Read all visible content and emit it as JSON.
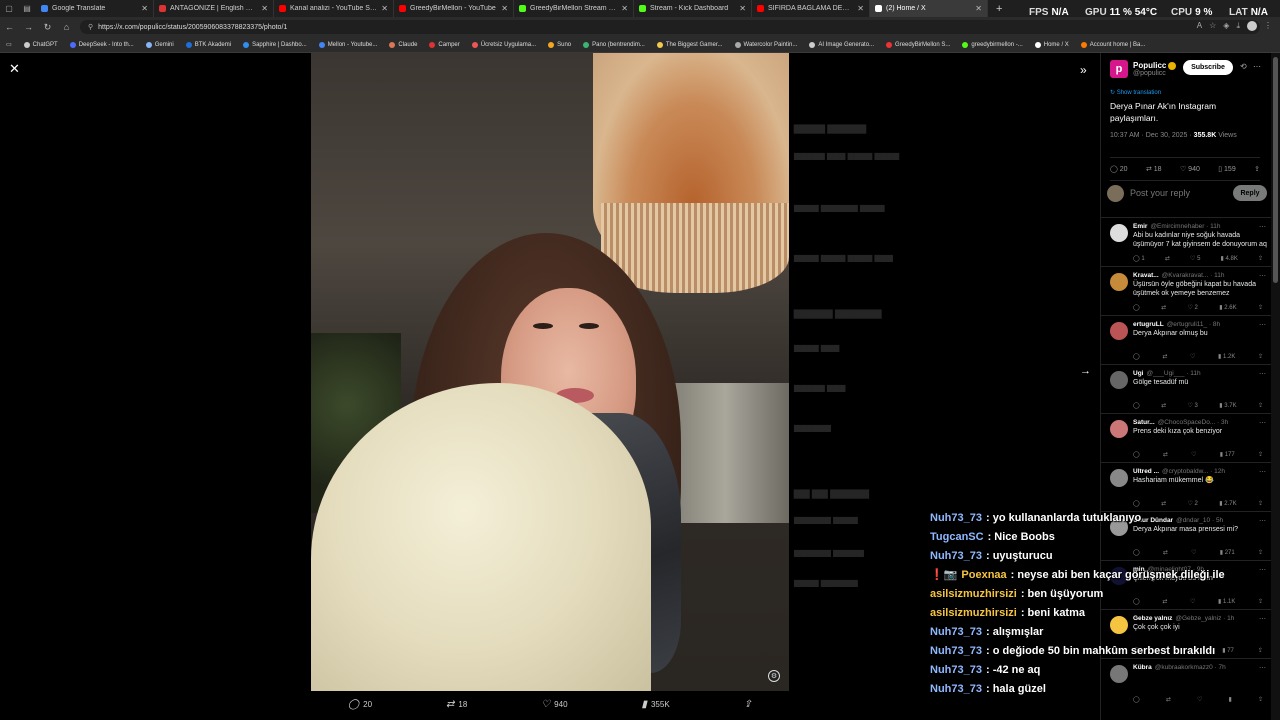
{
  "browser": {
    "tabs": [
      {
        "title": "Google Translate",
        "color": "#4285f4",
        "width": 118
      },
      {
        "title": "ANTAGONIZE | English meaning -",
        "color": "#d33",
        "width": 120
      },
      {
        "title": "Kanal analizi - YouTube Studio",
        "color": "#ff0000",
        "width": 120
      },
      {
        "title": "GreedyBirMellon - YouTube",
        "color": "#ff0000",
        "width": 120
      },
      {
        "title": "GreedyBirMellon Stream - Watch",
        "color": "#53fc18",
        "width": 120
      },
      {
        "title": "Stream - Kick Dashboard",
        "color": "#53fc18",
        "width": 118
      },
      {
        "title": "SIFIRDA BAĞLAMA DERSİ 5 ( Nota",
        "color": "#ff0000",
        "width": 118
      },
      {
        "title": "(2) Home / X",
        "color": "#ffffff",
        "width": 118,
        "active": true
      }
    ],
    "new_tab": "+",
    "url": "https://x.com/populicc/status/2005906083378823375/photo/1",
    "bookmarks": [
      {
        "label": "ChatGPT",
        "color": "#ccc"
      },
      {
        "label": "DeepSeek - Into th...",
        "color": "#4d6bfe"
      },
      {
        "label": "Gemini",
        "color": "#8ab4f8"
      },
      {
        "label": "BTK Akademi",
        "color": "#1e6fd9"
      },
      {
        "label": "Sapphire | Dashbo...",
        "color": "#2f8ff1"
      },
      {
        "label": "Mellon - Youtube...",
        "color": "#4285f4"
      },
      {
        "label": "Claude",
        "color": "#d97757"
      },
      {
        "label": "Camper",
        "color": "#d33"
      },
      {
        "label": "Ücretsiz Uygulama...",
        "color": "#e55"
      },
      {
        "label": "Suno",
        "color": "#f5a623"
      },
      {
        "label": "Pano (bentrendim...",
        "color": "#3cb371"
      },
      {
        "label": "The Biggest Gamer...",
        "color": "#f2c94c"
      },
      {
        "label": "Watercolor Paintin...",
        "color": "#aaa"
      },
      {
        "label": "AI Image Generato...",
        "color": "#ccc"
      },
      {
        "label": "GreedyBirMellon S...",
        "color": "#e33"
      },
      {
        "label": "greedybirmellon -...",
        "color": "#53fc18"
      },
      {
        "label": "Home / X",
        "color": "#fff"
      },
      {
        "label": "Account home | Ba...",
        "color": "#ff7a00"
      }
    ]
  },
  "hud": {
    "fps_label": "FPS",
    "fps_value": "N/A",
    "gpu_label": "GPU",
    "gpu_value": "11 % 54°C",
    "cpu_label": "CPU",
    "cpu_value": "9 %",
    "lat_label": "LAT",
    "lat_value": "N/A"
  },
  "viewer": {
    "close_glyph": "✕",
    "expand_glyph": "»",
    "next_glyph": "→",
    "alt_glyph": "⚙",
    "actions": {
      "replies": "20",
      "reposts": "18",
      "likes": "940",
      "views": "355K"
    }
  },
  "tweet": {
    "author_name": "Populicc",
    "author_handle": "@populicc",
    "logo_letter": "p",
    "subscribe": "Subscribe",
    "show_translation": "Show translation",
    "text": "Derya Pınar Ak'ın Instagram paylaşımları.",
    "time": "10:37 AM · Dec 30, 2025 · ",
    "views_count": "355.8K",
    "views_label": " Views",
    "stats": {
      "replies": "20",
      "reposts": "18",
      "likes": "940",
      "bookmarks": "159"
    },
    "reply_placeholder": "Post your reply",
    "reply_button": "Reply"
  },
  "replies": [
    {
      "name": "Emir",
      "handle": "@Emircimnehaber · 11h",
      "text": "Abi bu kadınlar niye soğuk havada üşümüyor 7 kat giyinsem de donuyorum aq",
      "r": "1",
      "rt": "",
      "l": "5",
      "v": "4.8K",
      "av": "#ddd"
    },
    {
      "name": "Kravat...",
      "handle": "@Kvarakravat... · 11h",
      "text": "Üşürsün öyle göbeğini kapat bu havada üşütmek ok yemeye benzemez",
      "r": "",
      "rt": "",
      "l": "2",
      "v": "2.6K",
      "av": "#c58a3a"
    },
    {
      "name": "ertugruLL",
      "handle": "@ertugruli11_ · 8h",
      "text": "Derya Akpınar olmuş bu",
      "r": "",
      "rt": "",
      "l": "",
      "v": "1.2K",
      "av": "#b55"
    },
    {
      "name": "Ugi",
      "handle": "@___Ugi___ · 11h",
      "text": "Gölge tesadüf mü",
      "r": "",
      "rt": "",
      "l": "3",
      "v": "3.7K",
      "av": "#666"
    },
    {
      "name": "Satur...",
      "handle": "@ChocoSpaceDo... · 3h",
      "text": "Prens deki kıza çok benziyor",
      "r": "",
      "rt": "",
      "l": "",
      "v": "177",
      "av": "#c77"
    },
    {
      "name": "Ultred ...",
      "handle": "@cryptobaldw... · 12h",
      "text": "Hashariam mükemmel 😂",
      "r": "",
      "rt": "",
      "l": "2",
      "v": "2.7K",
      "av": "#888"
    },
    {
      "name": "Onur Dündar",
      "handle": "@dndar_10 · 5h",
      "text": "Derya Akpınar masa prensesi mi?",
      "r": "",
      "rt": "",
      "l": "",
      "v": "271",
      "av": "#999"
    },
    {
      "name": "min",
      "handle": "@minaelight07 · 9h",
      "text": "Çilleri yok muydu bu kızın",
      "r": "",
      "rt": "",
      "l": "",
      "v": "1.1K",
      "av": "#113"
    },
    {
      "name": "Gebze yalnız",
      "handle": "@Gebze_yalniz · 1h",
      "text": "Çok çok çok iyi",
      "r": "",
      "rt": "",
      "l": "",
      "v": "77",
      "av": "#f5c542"
    },
    {
      "name": "Kübra",
      "handle": "@kubraakorkmazz0 · 7h",
      "text": "",
      "r": "",
      "rt": "",
      "l": "",
      "v": "",
      "av": "#777"
    }
  ],
  "chat": [
    {
      "user": "Nuh73_73",
      "msg": ": yo kullananlarda tutuklanıyo",
      "color": "#8fb8ff"
    },
    {
      "user": "TugcanSC",
      "msg": ": Nice Boobs",
      "color": "#8fb8ff"
    },
    {
      "user": "Nuh73_73",
      "msg": ": uyuşturucu",
      "color": "#8fb8ff"
    },
    {
      "user": "Poexnaa",
      "msg": ": neyse abi ben kaçar görüşmek dileği ile",
      "color": "#f5c542",
      "badges": "❗📷"
    },
    {
      "user": "asilsizmuzhirsizi",
      "msg": ": ben üşüyorum",
      "color": "#f5c542"
    },
    {
      "user": "asilsizmuzhirsizi",
      "msg": ": beni katma",
      "color": "#f5c542"
    },
    {
      "user": "Nuh73_73",
      "msg": ": alışmışlar",
      "color": "#8fb8ff"
    },
    {
      "user": "Nuh73_73",
      "msg": ": o değiode 50 bin mahkûm serbest bırakıldı",
      "color": "#8fb8ff"
    },
    {
      "user": "Nuh73_73",
      "msg": ": -42 ne aq",
      "color": "#8fb8ff"
    },
    {
      "user": "Nuh73_73",
      "msg": ": hala güzel",
      "color": "#8fb8ff"
    }
  ]
}
